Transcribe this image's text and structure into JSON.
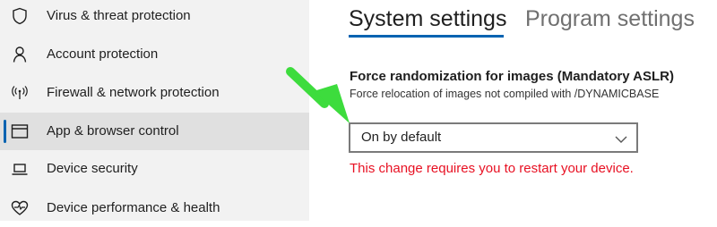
{
  "sidebar": {
    "items": [
      {
        "label": "Virus & threat protection",
        "icon": "shield-icon"
      },
      {
        "label": "Account protection",
        "icon": "person-icon"
      },
      {
        "label": "Firewall & network protection",
        "icon": "wireless-antenna-icon"
      },
      {
        "label": "App & browser control",
        "icon": "app-window-icon",
        "selected": true
      },
      {
        "label": "Device security",
        "icon": "laptop-icon"
      },
      {
        "label": "Device performance & health",
        "icon": "heart-icon"
      }
    ]
  },
  "tabs": [
    {
      "label": "System settings",
      "active": true
    },
    {
      "label": "Program settings",
      "active": false
    }
  ],
  "setting": {
    "title": "Force randomization for images (Mandatory ASLR)",
    "description": "Force relocation of images not compiled with /DYNAMICBASE",
    "dropdown_value": "On by default",
    "warning": "This change requires you to restart your device."
  },
  "colors": {
    "accent": "#0063b1",
    "warning": "#e81123",
    "annotation_arrow": "#3ddc3d",
    "sidebar_bg": "#f2f2f2",
    "selected_bg": "#e0e0e0"
  },
  "annotation": {
    "icon": "green-arrow-icon"
  }
}
